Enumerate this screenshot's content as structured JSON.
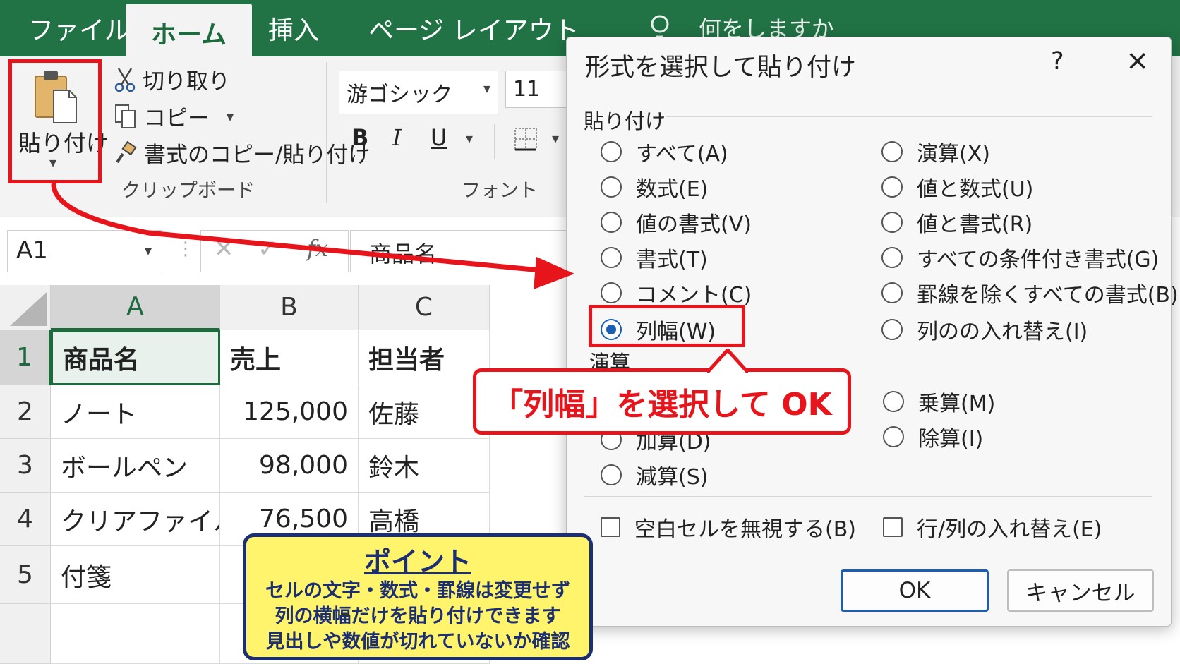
{
  "tabs": [
    {
      "label": "ファイル",
      "active": false
    },
    {
      "label": "ホーム",
      "active": true
    },
    {
      "label": "挿入",
      "active": false
    },
    {
      "label": "ページ レイアウト",
      "active": false
    }
  ],
  "search": {
    "text": "何をしますか"
  },
  "clipboard": {
    "paste_label": "貼り付け",
    "cut_label": "切り取り",
    "copy_label": "コピー",
    "format_painter_label": "書式のコピー/貼り付け",
    "group_label": "クリップボード"
  },
  "font": {
    "family": "游ゴシック",
    "size": "11",
    "bold": "B",
    "italic": "I",
    "underline": "U",
    "group_label": "フォント"
  },
  "formula_bar": {
    "namebox": "A1",
    "fx": "fx",
    "formula": "商品名"
  },
  "grid": {
    "columns": [
      "A",
      "B",
      "C"
    ],
    "rows": [
      "1",
      "2",
      "3",
      "4",
      "5"
    ],
    "cells": [
      [
        "商品名",
        "売上",
        "担当者"
      ],
      [
        "ノート",
        "125,000",
        "佐藤"
      ],
      [
        "ボールペン",
        "98,000",
        "鈴木"
      ],
      [
        "クリアファイル",
        "76,500",
        "高橋"
      ],
      [
        "付箋",
        "",
        ""
      ]
    ]
  },
  "dialog": {
    "title": "形式を選択して貼り付け",
    "help": "?",
    "close": "×",
    "paste_group": "貼り付け",
    "paste_left": [
      "すべて(A)",
      "数式(E)",
      "値の書式(V)",
      "書式(T)",
      "コメント(C)",
      "列幅(W)"
    ],
    "paste_right": [
      "演算(X)",
      "値と数式(U)",
      "値と書式(R)",
      "すべての条件付き書式(G)",
      "罫線を除くすべての書式(B)",
      "列のの入れ替え(I)"
    ],
    "selected": "列幅(W)",
    "operation_group": "演算",
    "operation_left": [
      "加算(D)",
      "減算(S)"
    ],
    "operation_right": [
      "乗算(M)",
      "除算(I)"
    ],
    "skip_blanks": "空白セルを無視する(B)",
    "transpose": "行/列の入れ替え(E)",
    "ok": "OK",
    "cancel": "キャンセル"
  },
  "callout": {
    "text": "「列幅」を選択して OK"
  },
  "point": {
    "title": "ポイント",
    "lines": [
      "セルの文字・数式・罫線は変更せず",
      "列の横幅だけを貼り付けできます",
      "見出しや数値が切れていないか確認"
    ]
  },
  "colors": {
    "ribbon": "#217346",
    "annotation": "#e8141c",
    "point_bg": "#fff46b",
    "point_border": "#1c2f73",
    "radio_selected": "#1a5fb4"
  }
}
